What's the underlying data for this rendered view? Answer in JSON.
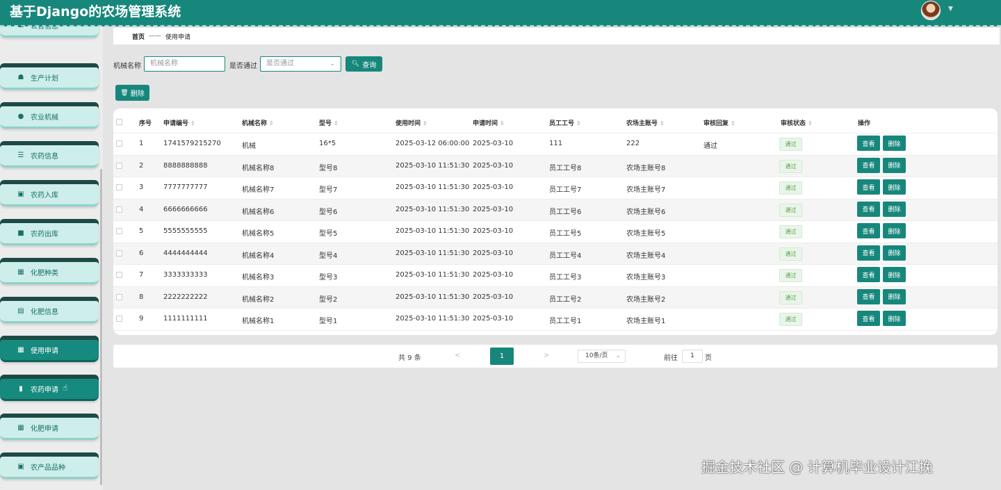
{
  "header": {
    "title": "基于Django的农场管理系统"
  },
  "sidebar": {
    "items": [
      {
        "label": "公告信息",
        "icon": "list-icon",
        "glyph": "☰"
      },
      {
        "label": "生产计划",
        "icon": "thumb-icon",
        "glyph": "☗"
      },
      {
        "label": "农业机械",
        "icon": "pin-icon",
        "glyph": "●"
      },
      {
        "label": "农药信息",
        "icon": "list-icon",
        "glyph": "☰"
      },
      {
        "label": "农药入库",
        "icon": "clipboard-icon",
        "glyph": "▣"
      },
      {
        "label": "农药出库",
        "icon": "monitor-icon",
        "glyph": "■"
      },
      {
        "label": "化肥种类",
        "icon": "grid-icon",
        "glyph": "▦"
      },
      {
        "label": "化肥信息",
        "icon": "device-icon",
        "glyph": "▤"
      },
      {
        "label": "使用申请",
        "icon": "grid-icon",
        "glyph": "▦"
      },
      {
        "label": "农药申请",
        "icon": "bar-chart-icon",
        "glyph": "▮"
      },
      {
        "label": "化肥申请",
        "icon": "grid-icon",
        "glyph": "▦"
      },
      {
        "label": "农产品品种",
        "icon": "clipboard-icon",
        "glyph": "▣"
      }
    ]
  },
  "breadcrumb": {
    "home": "首页",
    "separator": "——",
    "current": "使用申请"
  },
  "search": {
    "machine_label": "机械名称",
    "machine_placeholder": "机械名称",
    "approved_label": "是否通过",
    "approved_placeholder": "是否通过",
    "query_button": "查询",
    "delete_button": "删除"
  },
  "table": {
    "headers": [
      "序号",
      "申请编号",
      "机械名称",
      "型号",
      "使用时间",
      "申请时间",
      "员工工号",
      "农场主账号",
      "审核回复",
      "审核状态",
      "操作"
    ],
    "rows": [
      [
        "1",
        "1741579215270",
        "机械",
        "16*5",
        "2025-03-12 06:00:00",
        "2025-03-10",
        "111",
        "222",
        "通过",
        "通过"
      ],
      [
        "2",
        "8888888888",
        "机械名称8",
        "型号8",
        "2025-03-10 11:51:30",
        "2025-03-10",
        "员工工号8",
        "农场主账号8",
        "",
        "通过"
      ],
      [
        "3",
        "7777777777",
        "机械名称7",
        "型号7",
        "2025-03-10 11:51:30",
        "2025-03-10",
        "员工工号7",
        "农场主账号7",
        "",
        "通过"
      ],
      [
        "4",
        "6666666666",
        "机械名称6",
        "型号6",
        "2025-03-10 11:51:30",
        "2025-03-10",
        "员工工号6",
        "农场主账号6",
        "",
        "通过"
      ],
      [
        "5",
        "5555555555",
        "机械名称5",
        "型号5",
        "2025-03-10 11:51:30",
        "2025-03-10",
        "员工工号5",
        "农场主账号5",
        "",
        "通过"
      ],
      [
        "6",
        "4444444444",
        "机械名称4",
        "型号4",
        "2025-03-10 11:51:30",
        "2025-03-10",
        "员工工号4",
        "农场主账号4",
        "",
        "通过"
      ],
      [
        "7",
        "3333333333",
        "机械名称3",
        "型号3",
        "2025-03-10 11:51:30",
        "2025-03-10",
        "员工工号3",
        "农场主账号3",
        "",
        "通过"
      ],
      [
        "8",
        "2222222222",
        "机械名称2",
        "型号2",
        "2025-03-10 11:51:30",
        "2025-03-10",
        "员工工号2",
        "农场主账号2",
        "",
        "通过"
      ],
      [
        "9",
        "1111111111",
        "机械名称1",
        "型号1",
        "2025-03-10 11:51:30",
        "2025-03-10",
        "员工工号1",
        "农场主账号1",
        "",
        "通过"
      ]
    ],
    "view_label": "查看",
    "delete_label": "删除"
  },
  "pagination": {
    "total": "共 9 条",
    "prev": "<",
    "current_page": "1",
    "next": ">",
    "page_size": "10条/页",
    "goto_prefix": "前往",
    "goto_value": "1",
    "goto_suffix": "页"
  },
  "watermark": "掘金技术社区 @ 计算机毕业设计江挽"
}
